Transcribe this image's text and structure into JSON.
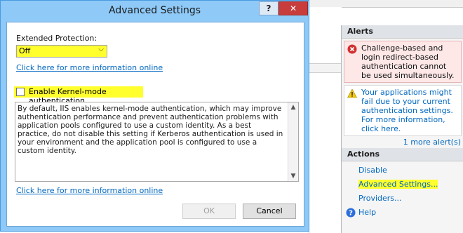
{
  "dialog": {
    "title": "Advanced Settings",
    "help_label": "?",
    "close_label": "✕",
    "extended_protection_label": "Extended Protection:",
    "extended_protection_value": "Off",
    "info_link_1": "Click here for more information online",
    "kernel_mode_label": "Enable Kernel-mode authentication",
    "kernel_mode_checked": false,
    "description": "By default, IIS enables kernel-mode authentication, which may improve authentication performance and prevent authentication problems with application pools configured to use a custom identity. As a best practice, do not disable this setting if Kerberos authentication is used in your environment and the application pool is configured to use a custom identity.",
    "info_link_2": "Click here for more information online",
    "ok_label": "OK",
    "cancel_label": "Cancel"
  },
  "actions_pane": {
    "alerts_header": "Alerts",
    "alerts": [
      {
        "type": "error",
        "icon": "error-icon",
        "text": "Challenge-based and login redirect-based authentication cannot be used simultaneously."
      },
      {
        "type": "warning",
        "icon": "warning-icon",
        "text": "Your applications might fail due to your current authentication settings.  For more information, click here."
      }
    ],
    "more_alerts": "1 more alert(s)",
    "actions_header": "Actions",
    "actions": [
      {
        "label": "Disable"
      },
      {
        "label": "Advanced Settings..."
      },
      {
        "label": "Providers..."
      }
    ],
    "help_label": "Help"
  },
  "colors": {
    "highlight": "#ffff2e",
    "link": "#0067c0",
    "title_bar": "#8ec9f7",
    "close_button": "#c83c3c"
  }
}
